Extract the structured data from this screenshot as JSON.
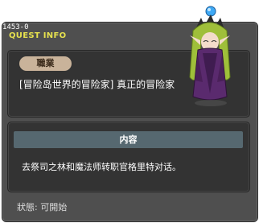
{
  "window": {
    "quest_id": "1453-0",
    "title": "QUEST INFO"
  },
  "job": {
    "badge": "職業",
    "text": "[冒险岛世界的冒险家] 真正的冒险家"
  },
  "content": {
    "header": "内容",
    "text": "去祭司之林和魔法师转职官格里特对话。"
  },
  "status": {
    "label": "狀態",
    "value": "可開始",
    "text": "狀態:  可開始"
  },
  "npc": {
    "name": "npc-portrait"
  }
}
